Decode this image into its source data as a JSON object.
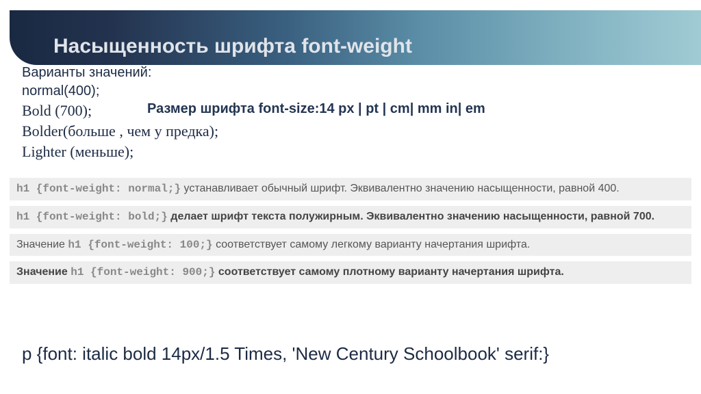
{
  "header": {
    "title": "Насыщенность шрифта  font-weight"
  },
  "variants": {
    "heading": "Варианты значений:",
    "l1": "normal(400);",
    "l2": "Bold (700);",
    "l3": "Bolder(больше , чем у предка);",
    "l4": "Lighter (меньше);"
  },
  "size_note": "Размер шрифта  font-size:14 px | pt | cm| mm in| em",
  "entries": [
    {
      "lead": "",
      "code": "h1 {font-weight: normal;}",
      "rest": " устанавливает обычный шрифт. Эквивалентно значению насыщенности, равной 400.",
      "strong": false
    },
    {
      "lead": "",
      "code": "h1 {font-weight: bold;}",
      "rest": " делает шрифт текста полужирным. Эквивалентно значению насыщенности, равной 700.",
      "strong": true
    },
    {
      "lead": "Значение ",
      "code": "h1 {font-weight: 100;}",
      "rest": " соответствует самому легкому варианту начертания шрифта.",
      "strong": false
    },
    {
      "lead": "Значение ",
      "code": "h1 {font-weight: 900;}",
      "rest": " соответствует самому плотному варианту начертания шрифта.",
      "strong": true
    }
  ],
  "shorthand": "p {font: italic bold 14px/1.5 Times, 'New Century Schoolbook'  serif:}"
}
